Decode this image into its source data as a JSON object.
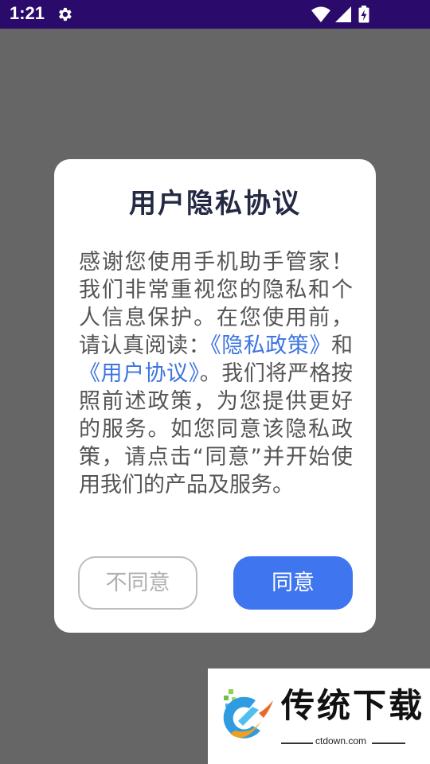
{
  "status_bar": {
    "time": "1:21",
    "icons": [
      "gear-icon",
      "wifi-icon",
      "signal-icon",
      "battery-charging-icon"
    ]
  },
  "dialog": {
    "title": "用户隐私协议",
    "body_part1": "感谢您使用手机助手管家！我们非常重视您的隐私和个人信息保护。在您使用前，请认真阅读：",
    "privacy_link": "《隐私政策》",
    "body_and": "和",
    "agreement_link": "《用户协议》",
    "body_part2": "。我们将严格按照前述政策，为您提供更好的服务。如您同意该隐私政策，请点击“同意”并开始使用我们的产品及服务。",
    "disagree_label": "不同意",
    "agree_label": "同意"
  },
  "watermark": {
    "title": "传统下载",
    "domain": "ctdown.com"
  },
  "colors": {
    "status_bar_bg": "#2a0a6b",
    "overlay": "#666666",
    "accent": "#3f76f0",
    "link": "#3d74e0",
    "title": "#252a44",
    "body_text": "#555555"
  }
}
